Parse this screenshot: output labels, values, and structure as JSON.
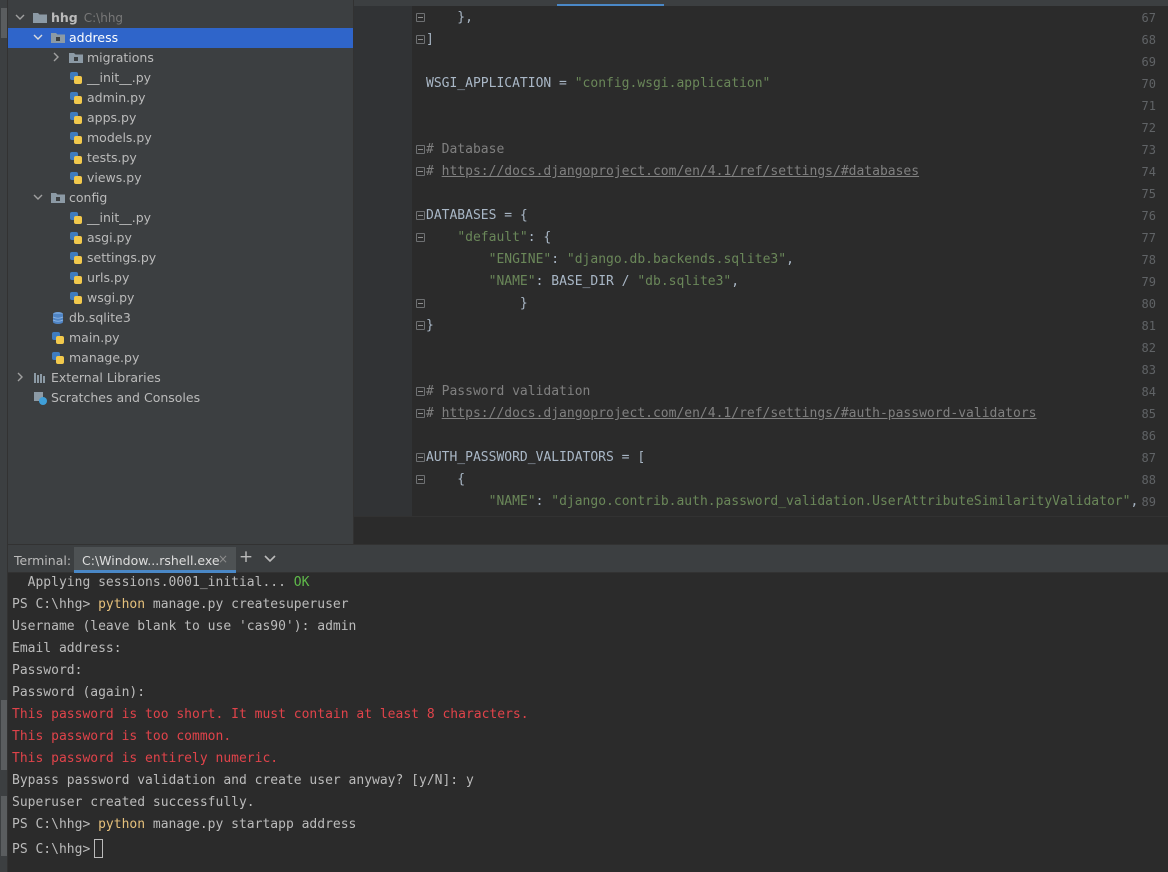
{
  "project_tree": {
    "root": {
      "name": "hhg",
      "path": "C:\\hhg"
    },
    "items": [
      {
        "label": "address",
        "type": "folder"
      },
      {
        "label": "migrations",
        "type": "folder"
      },
      {
        "label": "__init__.py",
        "type": "python"
      },
      {
        "label": "admin.py",
        "type": "python"
      },
      {
        "label": "apps.py",
        "type": "python"
      },
      {
        "label": "models.py",
        "type": "python"
      },
      {
        "label": "tests.py",
        "type": "python"
      },
      {
        "label": "views.py",
        "type": "python"
      },
      {
        "label": "config",
        "type": "folder"
      },
      {
        "label": "__init__.py",
        "type": "python"
      },
      {
        "label": "asgi.py",
        "type": "python"
      },
      {
        "label": "settings.py",
        "type": "python"
      },
      {
        "label": "urls.py",
        "type": "python"
      },
      {
        "label": "wsgi.py",
        "type": "python"
      },
      {
        "label": "db.sqlite3",
        "type": "database"
      },
      {
        "label": "main.py",
        "type": "python"
      },
      {
        "label": "manage.py",
        "type": "python"
      },
      {
        "label": "External Libraries",
        "type": "libraries"
      },
      {
        "label": "Scratches and Consoles",
        "type": "scratches"
      }
    ]
  },
  "editor": {
    "line_numbers": [
      "67",
      "68",
      "69",
      "70",
      "71",
      "72",
      "73",
      "74",
      "75",
      "76",
      "77",
      "78",
      "79",
      "80",
      "81",
      "82",
      "83",
      "84",
      "85",
      "86",
      "87",
      "88",
      "89"
    ],
    "code": {
      "l67": "    },",
      "l68": "]",
      "l70_name": "WSGI_APPLICATION = ",
      "l70_value": "\"config.wsgi.application\"",
      "l73": "# Database",
      "l74_prefix": "# ",
      "l74_url": "https://docs.djangoproject.com/en/4.1/ref/settings/#databases",
      "l76": "DATABASES = {",
      "l77_key": "\"default\"",
      "l77_rest": ": {",
      "l78_key": "\"ENGINE\"",
      "l78_sep": ": ",
      "l78_value": "\"django.db.backends.sqlite3\"",
      "l78_end": ",",
      "l79_key": "\"NAME\"",
      "l79_mid": ": BASE_DIR / ",
      "l79_value": "\"db.sqlite3\"",
      "l79_end": ",",
      "l80": "        }",
      "l81": "}",
      "l84": "# Password validation",
      "l85_prefix": "# ",
      "l85_url": "https://docs.djangoproject.com/en/4.1/ref/settings/#auth-password-validators",
      "l87": "AUTH_PASSWORD_VALIDATORS = [",
      "l88": "    {",
      "l89_key": "\"NAME\"",
      "l89_sep": ": ",
      "l89_value": "\"django.contrib.auth.password_validation.UserAttributeSimilarityValidator\"",
      "l89_end": ","
    }
  },
  "terminal": {
    "title": "Terminal:",
    "tab_label": "C:\\Window...rshell.exe",
    "close_glyph": "×",
    "add_glyph": "+",
    "lines": {
      "t1_text": "  Applying sessions.0001_initial... ",
      "t1_ok": "OK",
      "t2_prompt": "PS C:\\hhg> ",
      "t2_cmd": "python",
      "t2_args": " manage.py createsuperuser",
      "t3": "Username (leave blank to use 'cas90'): admin",
      "t4": "Email address:",
      "t5": "Password:",
      "t6": "Password (again):",
      "t7": "This password is too short. It must contain at least 8 characters.",
      "t8": "This password is too common.",
      "t9": "This password is entirely numeric.",
      "t10": "Bypass password validation and create user anyway? [y/N]: y",
      "t11": "Superuser created successfully.",
      "t12_prompt": "PS C:\\hhg> ",
      "t12_cmd": "python",
      "t12_args": " manage.py startapp address",
      "t13_prompt": "PS C:\\hhg>"
    }
  },
  "colors": {
    "selection": "#2f65ca",
    "string": "#6a8759",
    "comment": "#808080",
    "command": "#e5c07b",
    "error": "#e0434a",
    "ok": "#5fba4a"
  }
}
